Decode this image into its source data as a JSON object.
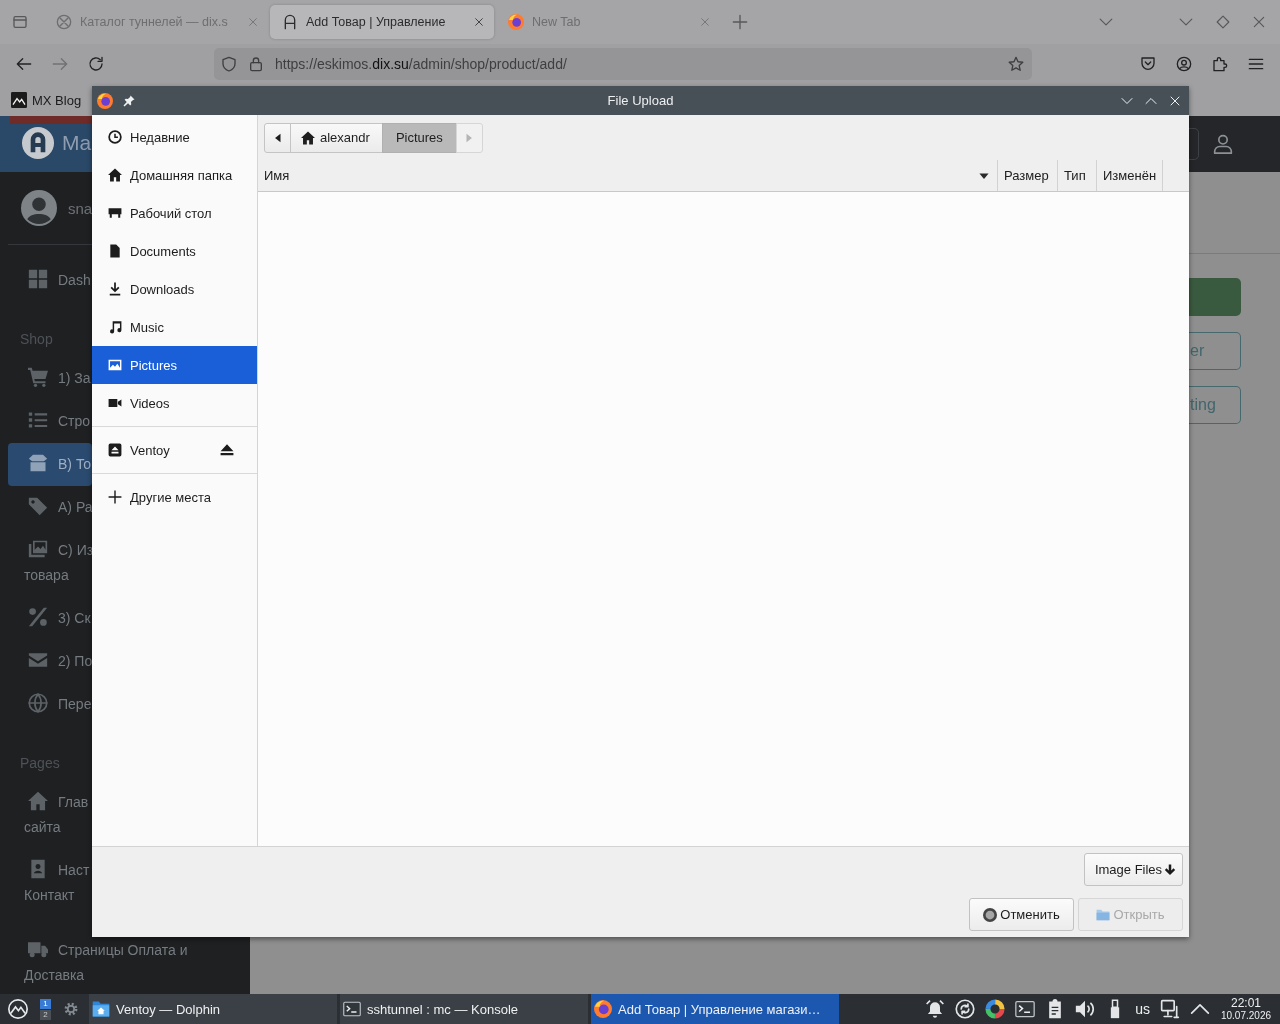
{
  "browser": {
    "tabs": [
      {
        "title": "Каталог туннелей — dix.s",
        "selected": false
      },
      {
        "title": "Add Товар | Управление",
        "selected": true
      },
      {
        "title": "New Tab",
        "selected": false
      }
    ],
    "nav_buttons": [
      {
        "kind": "back",
        "disabled": false
      },
      {
        "kind": "forward",
        "disabled": true
      },
      {
        "kind": "reload",
        "disabled": false
      }
    ],
    "address": {
      "host_start": "https://eskimos.",
      "domain": "dix.su",
      "path": "/admin/shop/product/add/"
    },
    "bookmarks": [
      {
        "label": "MX Blog"
      }
    ]
  },
  "page": {
    "brand": "Ma",
    "user": "sna",
    "menu": [
      {
        "kind": "link",
        "lines": [
          "Dash"
        ],
        "selected": false
      },
      {
        "kind": "heading",
        "label": "Shop"
      },
      {
        "kind": "link",
        "lines": [
          "1) За"
        ],
        "selected": false
      },
      {
        "kind": "link",
        "lines": [
          "Стро"
        ],
        "selected": false
      },
      {
        "kind": "link",
        "lines": [
          "В) То"
        ],
        "selected": true
      },
      {
        "kind": "link",
        "lines": [
          "А) Ра"
        ],
        "selected": false
      },
      {
        "kind": "link",
        "lines": [
          "С) Из",
          "товара"
        ],
        "selected": false
      },
      {
        "kind": "link",
        "lines": [
          "3) Ск"
        ],
        "selected": false
      },
      {
        "kind": "link",
        "lines": [
          "2) По"
        ],
        "selected": false
      },
      {
        "kind": "link",
        "lines": [
          "Пере"
        ],
        "selected": false
      },
      {
        "kind": "heading",
        "label": "Pages"
      },
      {
        "kind": "link",
        "lines": [
          "Глав",
          "сайта"
        ],
        "selected": false
      },
      {
        "kind": "link",
        "lines": [
          "Наст",
          "Контакт"
        ],
        "selected": false
      },
      {
        "kind": "link",
        "lines": [
          "Страницы Оплата и",
          "Доставка"
        ],
        "selected": false
      }
    ],
    "actions": [
      {
        "kind": "solid"
      },
      {
        "kind": "outline",
        "label": "er"
      },
      {
        "kind": "outline",
        "label": "ting"
      }
    ]
  },
  "dialog": {
    "title": "File Upload",
    "places": [
      [
        {
          "kind": "place",
          "label": "Недавние",
          "selected": false
        },
        {
          "kind": "place",
          "label": "Домашняя папка",
          "selected": false
        },
        {
          "kind": "place",
          "label": "Рабочий стол",
          "selected": false
        },
        {
          "kind": "place",
          "label": "Documents",
          "selected": false
        },
        {
          "kind": "place",
          "label": "Downloads",
          "selected": false
        },
        {
          "kind": "place",
          "label": "Music",
          "selected": false
        },
        {
          "kind": "place",
          "label": "Pictures",
          "selected": true
        },
        {
          "kind": "place",
          "label": "Videos",
          "selected": false
        }
      ],
      [
        {
          "kind": "device",
          "label": "Ventoy",
          "selected": false
        }
      ],
      [
        {
          "kind": "action",
          "label": "Другие места",
          "selected": false
        }
      ]
    ],
    "path_back": {
      "disabled": false
    },
    "path": [
      {
        "kind": "home",
        "label": "alexandr",
        "selected": false
      },
      {
        "kind": "folder",
        "label": "Pictures",
        "selected": true
      }
    ],
    "path_forward": {
      "disabled": true
    },
    "columns": [
      {
        "label": "Имя",
        "sorted": true
      },
      {
        "label": "Размер",
        "sorted": false
      },
      {
        "label": "Тип",
        "sorted": false
      },
      {
        "label": "Изменён",
        "sorted": false
      }
    ],
    "filter": "Image Files",
    "buttons": [
      {
        "kind": "cancel",
        "label": "Отменить",
        "disabled": false
      },
      {
        "kind": "open",
        "label": "Открыть",
        "disabled": true
      }
    ]
  },
  "taskbar": {
    "desktops": [
      {
        "label": "1",
        "selected": true
      },
      {
        "label": "2",
        "selected": false
      }
    ],
    "tasks": [
      {
        "kind": "files",
        "title": "Ventoy — Dolphin",
        "selected": false
      },
      {
        "kind": "terminal",
        "title": "sshtunnel : mc — Konsole",
        "selected": false
      },
      {
        "kind": "browser",
        "title": "Add Товар | Управление магази…",
        "selected": true
      }
    ],
    "keyboard_layout": "us",
    "time": "22:01",
    "date": "10.07.2026"
  }
}
